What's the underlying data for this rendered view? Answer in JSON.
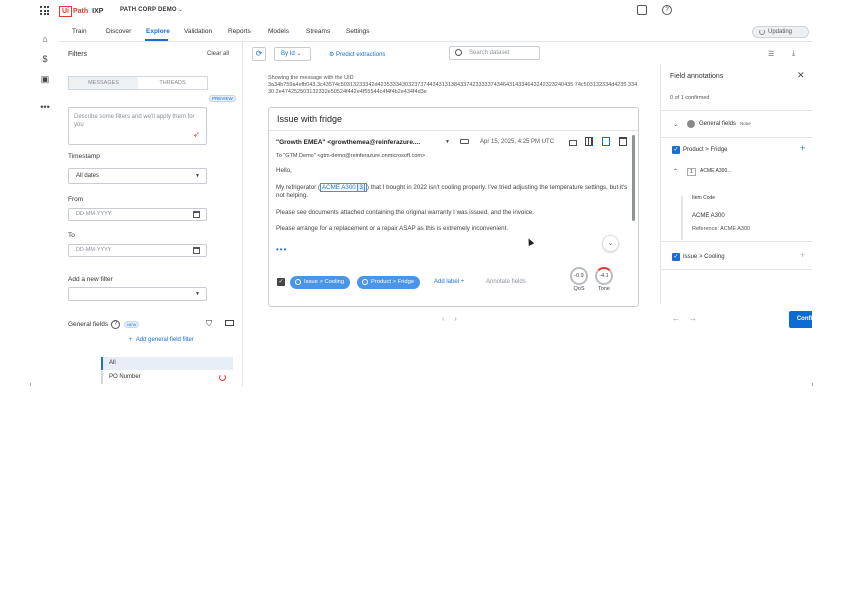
{
  "topbar": {
    "logo_ui": "Ui",
    "logo_path": "Path",
    "product": "IXP",
    "org_name": "PATH CORP DEMO"
  },
  "nav": {
    "tabs": [
      "Train",
      "Discover",
      "Explore",
      "Validation",
      "Reports",
      "Models",
      "Streams",
      "Settings"
    ],
    "active_tab": "Explore",
    "status": "Updating"
  },
  "filters": {
    "title": "Filters",
    "clear_all": "Clear all",
    "segment_messages": "MESSAGES",
    "segment_threads": "THREADS",
    "preview_badge": "PREVIEW",
    "ai_placeholder": "Describe some filters and we'll apply them for you",
    "timestamp_label": "Timestamp",
    "timestamp_value": "All dates",
    "from_label": "From",
    "from_placeholder": "DD-MM-YYYY",
    "to_label": "To",
    "to_placeholder": "DD-MM-YYYY",
    "add_filter_label": "Add a new filter",
    "general_fields_label": "General fields",
    "new_badge": "NEW",
    "add_general_field": "Add general field filter",
    "list_items": [
      "All",
      "PO Number"
    ]
  },
  "toolbar": {
    "sort_label": "By Id",
    "predict_label": "Predict extractions",
    "search_placeholder": "Search dataset"
  },
  "message": {
    "uid_caption": "Showing the message with the UID",
    "uid": "3a34b759a4efb043.3c43574c50313233342d4235333430323737443431313843374233333743464314334643242323240435 74c503132334d4235 33430 2e474252503132332e50524f442e4f55544c4f4f4b2e434f4d3e",
    "title": "Issue with fridge",
    "from": "\"Growth EMEA\" <growthemea@reinferazure....",
    "date": "Apr 15, 2025, 4:25 PM UTC",
    "to": "To \"GTM Demo\" <gtm-demo@reinferazure.onmicrosoft.com>",
    "greeting": "Hello,",
    "p1_before": "My refrigerator (",
    "p1_highlight": "ACME A300",
    "p1_highlight_tag": "3",
    "p1_after": ") that I bought in 2022 isn't cooling properly. I've tried adjusting the temperature settings, but it's not helping.",
    "p2": "Please see documents attached containing the original warranty I was issued, and the invoice.",
    "p3": "Please arrange for a replacement or a repair ASAP as this is extremely inconvenient.",
    "more": "•••",
    "labels": [
      "Issue > Cooling",
      "Product > Fridge"
    ],
    "add_label": "Add label",
    "annotate_fields": "Annotate fields",
    "qos_value": "-0.9",
    "qos_label": "QoS",
    "tone_value": "-4.1",
    "tone_label": "Tone"
  },
  "annotations": {
    "title": "Field annotations",
    "confirmed": "0 of 1 confirmed",
    "general_fields": "General fields",
    "general_fields_value": "None",
    "product_fridge": "Product > Fridge",
    "entry_index": "1",
    "entry_value": "ACME A300...",
    "item_code_label": "Item Code",
    "item_code_value": "ACME A300",
    "reference": "Reference: ACME A300",
    "issue_cooling": "Issue > Cooling",
    "confirm_all": "Confirm all"
  },
  "colors": {
    "accent": "#1a6fd1",
    "brand": "#e03a2f",
    "label_pill": "#4a95e8",
    "confirm_button": "#0b6bd3"
  }
}
